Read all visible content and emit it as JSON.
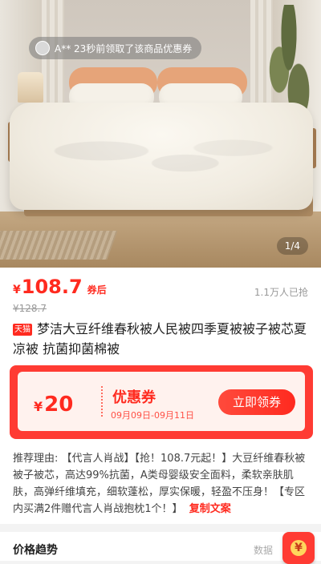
{
  "hero": {
    "coupon_toast": "A** 23秒前领取了该商品优惠券",
    "image_counter": "1/4"
  },
  "product": {
    "price_symbol": "¥",
    "price": "108.7",
    "price_tag": "券后",
    "sold": "1.1万人已抢",
    "original_price": "¥128.7",
    "store_badge": "天猫",
    "title": "梦洁大豆纤维春秋被人民被四季夏被被子被芯夏凉被 抗菌抑菌棉被"
  },
  "coupon": {
    "symbol": "¥",
    "amount": "20",
    "label": "优惠券",
    "date_range": "09月09日-09月11日",
    "claim_label": "立即领券"
  },
  "recommend": {
    "label": "推荐理由:",
    "text": "【代言人肖战】【抢！108.7元起！】大豆纤维春秋被被子被芯，高达99%抗菌，A类母婴级安全面料，柔软亲肤肌肤，高弹纤维填充，细软蓬松，厚实保暖，轻盈不压身！【专区内买满2件赠代言人肖战抱枕1个！】",
    "copy_label": "复制文案"
  },
  "trend": {
    "title": "价格趋势",
    "source": "数据"
  },
  "colors": {
    "accent": "#ff2a1f",
    "coupon_bg": "#ff3b33"
  }
}
